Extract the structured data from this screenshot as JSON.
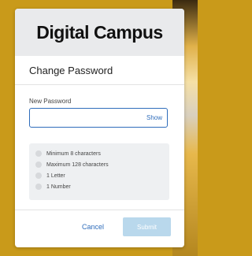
{
  "brand": {
    "name": "Digital Campus"
  },
  "dialog": {
    "title": "Change Password"
  },
  "form": {
    "new_password_label": "New Password",
    "new_password_value": "",
    "show_label": "Show"
  },
  "requirements": [
    {
      "label": "Minimum 8 characters",
      "met": false
    },
    {
      "label": "Maximum 128 characters",
      "met": false
    },
    {
      "label": "1 Letter",
      "met": false
    },
    {
      "label": "1 Number",
      "met": false
    }
  ],
  "actions": {
    "cancel_label": "Cancel",
    "submit_label": "Submit",
    "submit_enabled": false
  },
  "colors": {
    "accent": "#2f6dbb",
    "background": "#c99a1a",
    "submit_disabled": "#b9d8ec"
  }
}
